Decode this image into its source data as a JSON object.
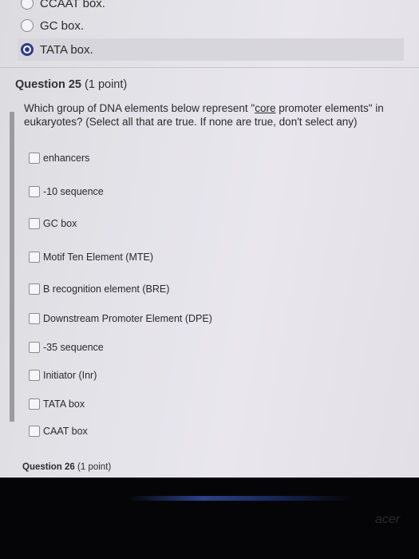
{
  "previous_question": {
    "options": [
      {
        "label": "CCAAT box.",
        "selected": false
      },
      {
        "label": "GC box.",
        "selected": false
      },
      {
        "label": "TATA box.",
        "selected": true
      }
    ]
  },
  "question": {
    "title": "Question 25",
    "points": "(1 point)",
    "text_before": "Which group of DNA elements below represent \"",
    "text_underlined": "core",
    "text_after": " promoter elements\" in eukaryotes? (Select all that are true.  If none are true, don't select any)",
    "options": [
      "enhancers",
      "-10 sequence",
      "GC box",
      "Motif Ten Element (MTE)",
      "B recognition element (BRE)",
      "Downstream Promoter Element (DPE)",
      "-35 sequence",
      "Initiator (Inr)",
      "TATA box",
      "CAAT box"
    ]
  },
  "next_question": {
    "title": "Question 26",
    "points": "(1 point)"
  },
  "bezel": {
    "brand": "acer"
  }
}
